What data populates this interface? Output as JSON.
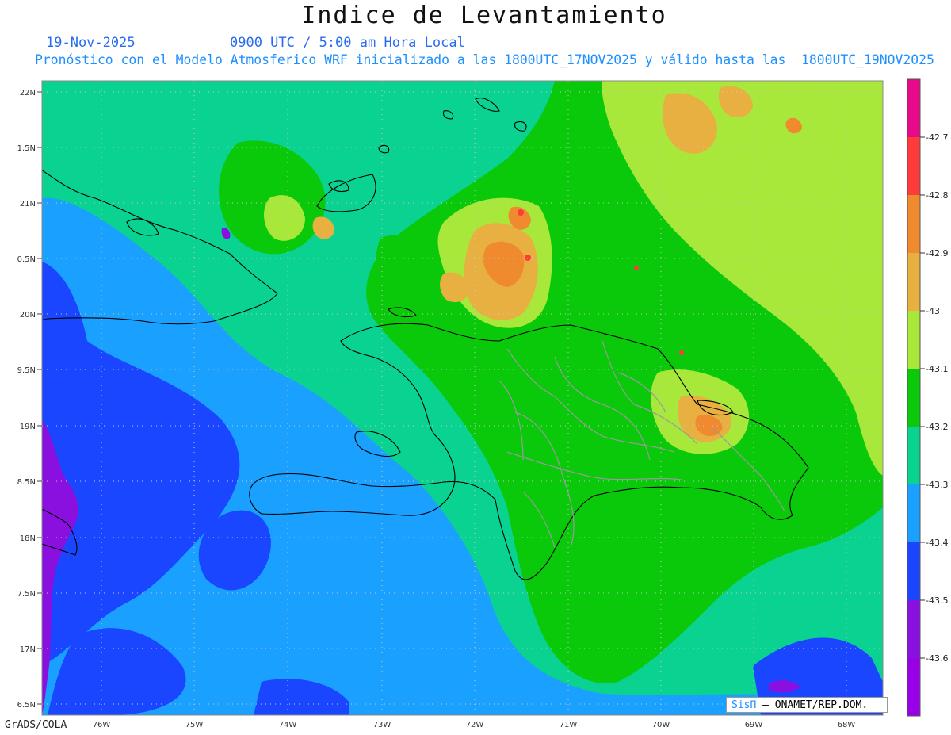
{
  "title": "Indice de Levantamiento",
  "date": "19-Nov-2025",
  "time": "0900 UTC / 5:00 am Hora Local",
  "description": "Pronóstico con el Modelo Atmosferico WRF inicializado a las 1800UTC_17NOV2025 y válido hasta las  1800UTC_19NOV2025",
  "credit": "GrADS/COLA",
  "badge": {
    "sis": "SisΠ",
    "rest": "– ONAMET/REP.DOM."
  },
  "lat_labels": [
    "22N",
    "1.5N",
    "21N",
    "0.5N",
    "20N",
    "9.5N",
    "19N",
    "8.5N",
    "18N",
    "7.5N",
    "17N",
    "6.5N"
  ],
  "lon_labels": [
    "76W",
    "75W",
    "74W",
    "73W",
    "72W",
    "71W",
    "70W",
    "69W",
    "68W"
  ],
  "colorbar": {
    "labels": [
      "-42.7",
      "-42.8",
      "-42.9",
      "-43",
      "-43.1",
      "-43.2",
      "-43.3",
      "-43.4",
      "-43.5",
      "-43.6"
    ],
    "colors": [
      "#e8088a",
      "#ff3a3a",
      "#f08a2e",
      "#e8b040",
      "#a8e83a",
      "#0ac80a",
      "#0ad290",
      "#1aa0ff",
      "#1a46ff",
      "#8a10e0",
      "#9a00e8"
    ]
  },
  "field_colors": {
    "base_green": "#0ad290",
    "light_blue": "#1aa0ff",
    "dark_blue": "#1a46ff",
    "purple": "#8a10e0",
    "green": "#0ac80a",
    "yellow_green": "#a8e83a",
    "tan": "#e8b040",
    "orange": "#f08a2e",
    "red": "#ff3a3a"
  }
}
